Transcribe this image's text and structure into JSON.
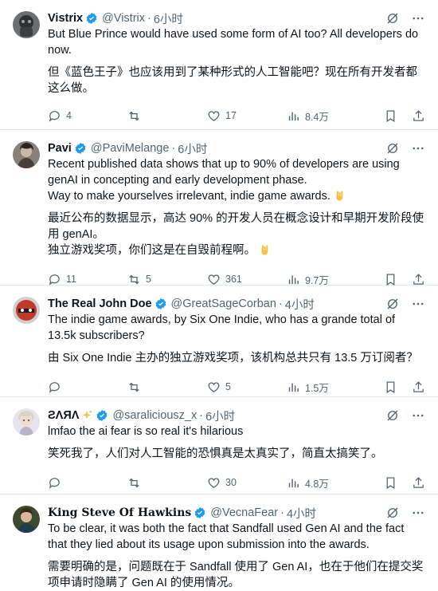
{
  "tweets": [
    {
      "name": "Vistrix",
      "handle": "@Vistrix",
      "time": "6小时",
      "text_en": "But Blue Prince would have used some form of AI too? All developers do now.",
      "text_zh": "但《蓝色王子》也应该用到了某种形式的人工智能吧？现在所有开发者都这么做。",
      "replies": "4",
      "retweets": "",
      "likes": "17",
      "views": "8.4万"
    },
    {
      "name": "Pavi",
      "handle": "@PaviMelange",
      "time": "6小时",
      "text_en": "Recent published data shows that up to 90% of developers are using genAI in concepting and early development phase.\nWay to make yourselves irrelevant, indie game awards.",
      "text_zh": "最近公布的数据显示，高达 90% 的开发人员在概念设计和早期开发阶段使用 genAI。\n独立游戏奖项，你们这是在自毁前程啊。",
      "replies": "11",
      "retweets": "5",
      "likes": "361",
      "views": "9.7万"
    },
    {
      "name": "The Real John Doe",
      "handle": "@GreatSageCorban",
      "time": "4小时",
      "text_en": "The indie game awards, by Six One Indie, who has a grande total of 13.5k subscribers?",
      "text_zh": "由 Six One Indie 主办的独立游戏奖项，该机构总共只有 13.5 万订阅者？",
      "replies": "",
      "retweets": "",
      "likes": "5",
      "views": "1.5万"
    },
    {
      "name": "ƧΛЯΛ",
      "handle": "@saraliciousz_x",
      "time": "6小时",
      "text_en": "lmfao the ai fear is so real it's hilarious",
      "text_zh": "笑死我了，人们对人工智能的恐惧真是太真实了，简直太搞笑了。",
      "replies": "",
      "retweets": "",
      "likes": "30",
      "views": "4.8万"
    },
    {
      "name": "King Steve Of Hawkins",
      "handle": "@VecnaFear",
      "time": "4小时",
      "text_en": "To be clear, it was both the fact that Sandfall used Gen AI and the fact that they lied about its usage upon submission into the awards.",
      "text_zh": "需要明确的是，问题既在于 Sandfall 使用了 Gen AI，也在于他们在提交奖项申请时隐瞒了 Gen AI 的使用情况。",
      "replies": "",
      "retweets": "",
      "likes": "",
      "views": ""
    }
  ],
  "colors": {
    "verified": "#1d9bf0",
    "muted": "#536471",
    "text": "#0f1419",
    "divider": "#e6e9ec"
  }
}
